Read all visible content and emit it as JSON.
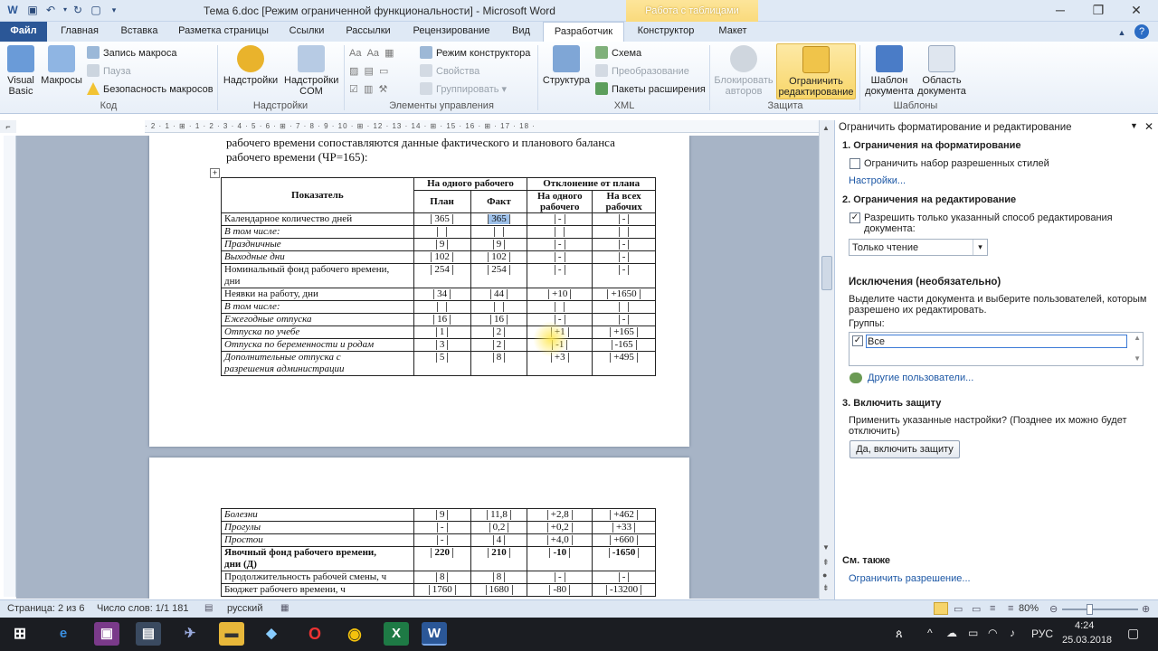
{
  "window": {
    "title": "Тема 6.doc [Режим ограниченной функциональности]  -  Microsoft Word",
    "context_tab_header": "Работа с таблицами"
  },
  "tabs": [
    "Файл",
    "Главная",
    "Вставка",
    "Разметка страницы",
    "Ссылки",
    "Рассылки",
    "Рецензирование",
    "Вид",
    "Разработчик",
    "Конструктор",
    "Макет"
  ],
  "ribbon": {
    "code": {
      "label": "Код",
      "visual_basic": "Visual Basic",
      "macros": "Макросы",
      "record_macro": "Запись макроса",
      "pause": "Пауза",
      "macro_security": "Безопасность макросов"
    },
    "addins": {
      "label": "Надстройки",
      "addins": "Надстройки",
      "com_addins": "Надстройки COM"
    },
    "controls": {
      "label": "Элементы управления",
      "design_mode": "Режим конструктора",
      "properties": "Свойства",
      "group": "Группировать"
    },
    "xml": {
      "label": "XML",
      "structure": "Структура",
      "schema": "Схема",
      "transform": "Преобразование",
      "expansion_packs": "Пакеты расширения"
    },
    "protect": {
      "label": "Защита",
      "block_authors": "Блокировать авторов",
      "restrict_editing": "Ограничить редактирование"
    },
    "templates": {
      "label": "Шаблоны",
      "doc_template": "Шаблон документа",
      "doc_panel": "Область документа"
    }
  },
  "ruler_text": "· 2 · 1 · ⊞ · 1 · 2 · 3 · 4 · 5 · 6 · ⊞ · 7 · 8 · 9 · 10 · ⊞ · 12 · 13 · 14 · ⊞ · 15 · 16 · ⊞ · 17 · 18 ·",
  "document": {
    "intro_line1": "рабочего времени сопоставляются данные фактического и планового баланса",
    "intro_line2": "рабочего времени (ЧР=165):",
    "headers": {
      "indicator": "Показатель",
      "per_worker": "На одного рабочего",
      "deviation": "Отклонение от плана",
      "plan": "План",
      "fact": "Факт",
      "dev_one": "На одного рабочего",
      "dev_all": "На всех рабочих"
    },
    "rows_page1": [
      {
        "label": "Календарное количество дней",
        "plan": "365",
        "fact": "365",
        "d1": "-",
        "d2": "-",
        "style": "n"
      },
      {
        "label": "В том числе:",
        "plan": "",
        "fact": "",
        "d1": "",
        "d2": "",
        "style": "i"
      },
      {
        "label": "Праздничные",
        "plan": "9",
        "fact": "9",
        "d1": "-",
        "d2": "-",
        "style": "ii"
      },
      {
        "label": "Выходные дни",
        "plan": "102",
        "fact": "102",
        "d1": "-",
        "d2": "-",
        "style": "ii"
      },
      {
        "label": "Номинальный фонд рабочего времени,",
        "label2": "дни",
        "plan": "254",
        "fact": "254",
        "d1": "-",
        "d2": "-",
        "style": "n2"
      },
      {
        "label": "Неявки на работу, дни",
        "plan": "34",
        "fact": "44",
        "d1": "+10",
        "d2": "+1650",
        "style": "n"
      },
      {
        "label": "В том числе:",
        "plan": "",
        "fact": "",
        "d1": "",
        "d2": "",
        "style": "i"
      },
      {
        "label": "Ежегодные отпуска",
        "plan": "16",
        "fact": "16",
        "d1": "-",
        "d2": "-",
        "style": "ii"
      },
      {
        "label": "Отпуска по учебе",
        "plan": "1",
        "fact": "2",
        "d1": "+1",
        "d2": "+165",
        "style": "ii"
      },
      {
        "label": "Отпуска по беременности и родам",
        "plan": "3",
        "fact": "2",
        "d1": "-1",
        "d2": "-165",
        "style": "ii"
      },
      {
        "label": "Дополнительные отпуска с",
        "label2": "разрешения администрации",
        "plan": "5",
        "fact": "8",
        "d1": "+3",
        "d2": "+495",
        "style": "ii2"
      }
    ],
    "rows_page2": [
      {
        "label": "Болезни",
        "plan": "9",
        "fact": "11,8",
        "d1": "+2,8",
        "d2": "+462",
        "style": "ii"
      },
      {
        "label": "Прогулы",
        "plan": "-",
        "fact": "0,2",
        "d1": "+0,2",
        "d2": "+33",
        "style": "ii"
      },
      {
        "label": "Простои",
        "plan": "-",
        "fact": "4",
        "d1": "+4,0",
        "d2": "+660",
        "style": "ii"
      },
      {
        "label": "Явочный фонд рабочего времени,",
        "label2": "дни (Д)",
        "plan": "220",
        "fact": "210",
        "d1": "-10",
        "d2": "-1650",
        "style": "b2"
      },
      {
        "label": "Продолжительность рабочей смены, ч",
        "plan": "8",
        "fact": "8",
        "d1": "-",
        "d2": "-",
        "style": "n"
      },
      {
        "label": "Бюджет рабочего времени, ч",
        "plan": "1760",
        "fact": "1680",
        "d1": "-80",
        "d2": "-13200",
        "style": "n"
      }
    ]
  },
  "pane": {
    "title": "Ограничить форматирование и редактирование",
    "s1_heading": "1. Ограничения на форматирование",
    "s1_checkbox": "Ограничить набор разрешенных стилей",
    "s1_link": "Настройки...",
    "s2_heading": "2. Ограничения на редактирование",
    "s2_checkbox_line1": "Разрешить только указанный способ редактирования",
    "s2_checkbox_line2": "документа:",
    "s2_select": "Только чтение",
    "exceptions_heading": "Исключения (необязательно)",
    "exceptions_desc1": "Выделите части документа и выберите пользователей, которым",
    "exceptions_desc2": "разрешено их редактировать.",
    "groups_label": "Группы:",
    "group_everyone": "Все",
    "other_users": "Другие пользователи...",
    "s3_heading": "3. Включить защиту",
    "s3_desc1": "Применить указанные настройки? (Позднее их можно будет",
    "s3_desc2": "отключить)",
    "s3_button": "Да, включить защиту",
    "see_also": "См. также",
    "see_also_link": "Ограничить разрешение..."
  },
  "status": {
    "page": "Страница: 2 из 6",
    "words": "Число слов: 1/1 181",
    "lang": "русский",
    "zoom": "80%"
  },
  "taskbar": {
    "lang": "РУС",
    "time": "4:24",
    "date": "25.03.2018"
  }
}
